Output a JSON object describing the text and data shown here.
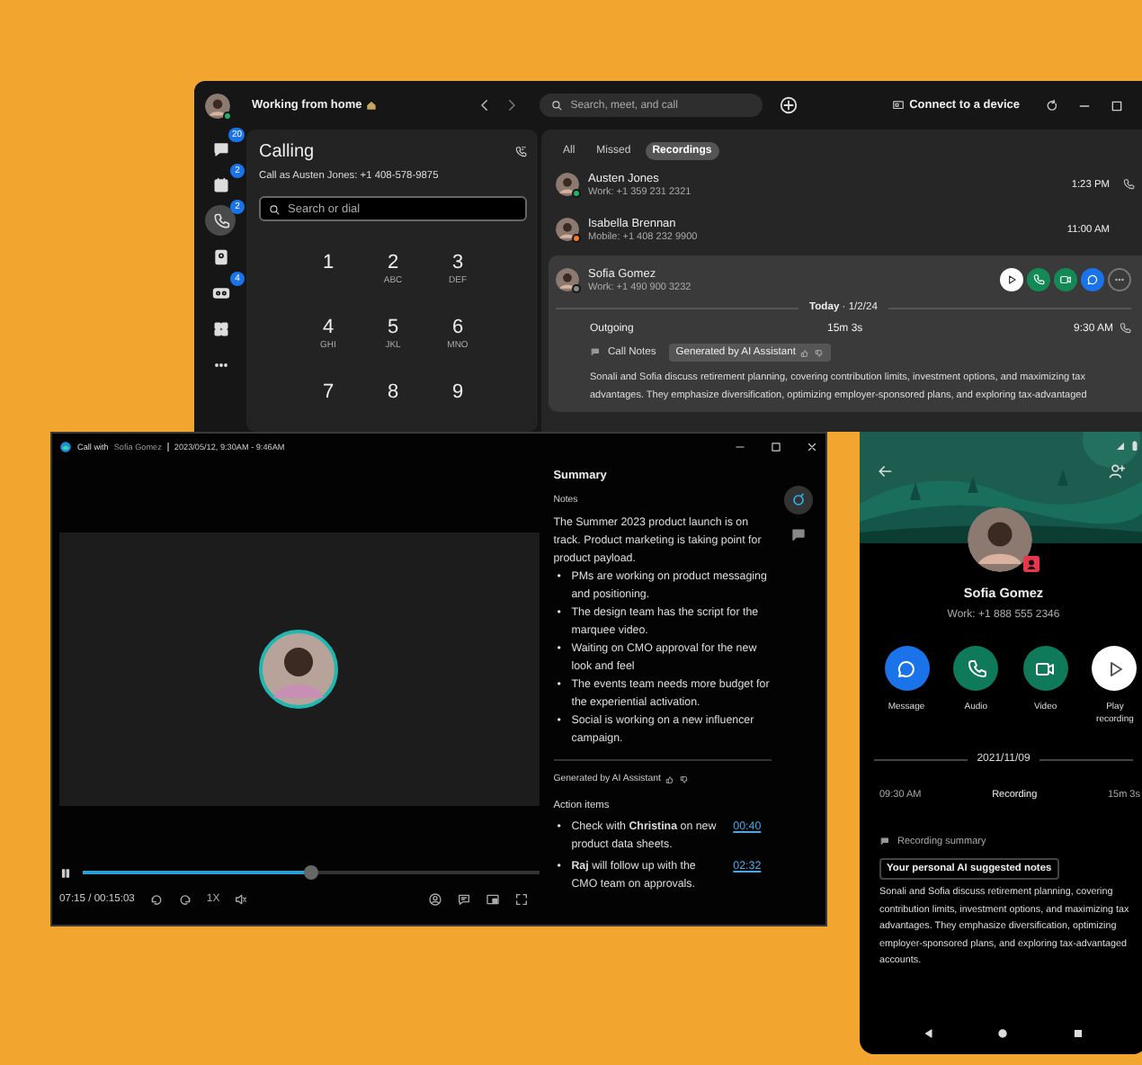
{
  "main_window": {
    "color": "#1db36a",
    "status_text": "Working from home",
    "search": {
      "placeholder": "Search, meet, and call"
    },
    "connect_label": "Connect to a device",
    "rail": [
      {
        "kind": "chat",
        "badge": "20",
        "selected": false
      },
      {
        "kind": "calendar",
        "badge": "2",
        "selected": false
      },
      {
        "kind": "phone",
        "badge": "2",
        "selected": true
      },
      {
        "kind": "contacts",
        "selected": false
      },
      {
        "kind": "voicemail",
        "badge": "4",
        "selected": false
      },
      {
        "kind": "apps",
        "selected": false
      },
      {
        "kind": "more",
        "selected": false
      }
    ],
    "calling": {
      "title": "Calling",
      "caller_id": "Call as Austen Jones: +1 408-578-9875",
      "search": {
        "placeholder": "Search or dial"
      },
      "keys": [
        {
          "digit": "1"
        },
        {
          "digit": "2",
          "letters": "ABC"
        },
        {
          "digit": "3",
          "letters": "DEF"
        },
        {
          "digit": "4",
          "letters": "GHI"
        },
        {
          "digit": "5",
          "letters": "JKL"
        },
        {
          "digit": "6",
          "letters": "MNO"
        },
        {
          "digit": "7"
        },
        {
          "digit": "8"
        },
        {
          "digit": "9"
        }
      ]
    },
    "tabs": [
      {
        "label": "All",
        "selected": false
      },
      {
        "label": "Missed",
        "selected": false
      },
      {
        "label": "Recordings",
        "selected": true
      }
    ],
    "calls": [
      {
        "name": "Austen Jones",
        "number": "Work: +1 359 231 2321",
        "time": "1:23 PM",
        "callback": true,
        "color": "#1db36a",
        "expanded": false
      },
      {
        "name": "Isabella Brennan",
        "number": "Mobile: +1 408 232 9900",
        "time": "11:00 AM",
        "callback": false,
        "color": "#f07c2a",
        "expanded": false
      },
      {
        "name": "Sofia Gomez",
        "number": "Work: +1 490 900 3232",
        "color": "#8a8a8a",
        "expanded": true,
        "actions": [
          {
            "kind": "play"
          },
          {
            "kind": "call"
          },
          {
            "kind": "video"
          },
          {
            "kind": "message"
          },
          {
            "kind": "more"
          }
        ],
        "date": "**Today** · 1/2/24",
        "direction": "Outgoing",
        "duration": "15m 3s",
        "call_time": "9:30 AM",
        "notes_label": "Call Notes",
        "notes_badge": "Generated by AI Assistant",
        "notes": "Sonali and Sofia discuss retirement planning, covering contribution limits, investment options, and maximizing tax advantages. They emphasize diversification, optimizing employer-sponsored plans, and exploring tax-advantaged"
      }
    ]
  },
  "video_window": {
    "title_prefix": "Call with",
    "title_name": "Sofia Gomez",
    "title_date": "2023/05/12, 9:30AM - 9:46AM",
    "progress": {
      "level": 0.5
    },
    "time": "07:15 / 00:15:03",
    "speed": "1X",
    "summary": {
      "title": "Summary",
      "notes_heading": "Notes",
      "intro": "The Summer 2023 product launch is on track. Product marketing is taking point for product payload.",
      "bullet": "•",
      "bullets": [
        "PMs are working on product messaging and positioning.",
        "The design team has the script for the marquee video.",
        "Waiting on CMO approval for the new look and feel",
        "The events team needs more budget for the experiential activation.",
        "Social is working on a new influencer campaign."
      ],
      "generated": "Generated by AI Assistant",
      "actions_heading": "Action items",
      "action_items": [
        {
          "text": "Check with **Christina** on new product data sheets.",
          "time": "00:40"
        },
        {
          "text": "**Raj** will follow up with the CMO team on approvals.",
          "time": "02:32"
        }
      ]
    },
    "side_tools": [
      {
        "kind": "ai",
        "selected": true
      },
      {
        "kind": "notes",
        "selected": false
      }
    ]
  },
  "phone": {
    "name": "Sofia Gomez",
    "number": "Work: +1 888 555 2346",
    "actions": [
      {
        "kind": "message",
        "label": "Message",
        "color": "#1a73e8"
      },
      {
        "kind": "call",
        "label": "Audio",
        "color": "#0e7a5a"
      },
      {
        "kind": "video",
        "label": "Video",
        "color": "#0e7a5a"
      },
      {
        "kind": "play",
        "label": "Play recording",
        "color": "#ffffff"
      }
    ],
    "date": "2021/11/09",
    "time": "09:30 AM",
    "type": "Recording",
    "duration": "15m 3s",
    "summary_label": "Recording summary",
    "summary_badge": "Your personal AI suggested notes",
    "summary": "Sonali and Sofia discuss retirement planning, covering contribution limits, investment options, and maximizing tax advantages. They emphasize diversification, optimizing employer-sponsored plans, and exploring tax-advantaged accounts."
  }
}
